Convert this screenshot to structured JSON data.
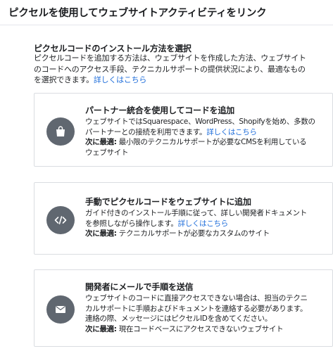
{
  "header": {
    "title": "ピクセルを使用してウェブサイトアクティビティをリンク"
  },
  "intro": {
    "title": "ピクセルコードのインストール方法を選択",
    "lines": [
      "ピクセルコードを追加する方法は、ウェブサイトを作成した方法、ウェブサイト",
      "のコードへのアクセス手段、テクニカルサポートの提供状況により、最適なもの",
      "を選択できます。"
    ],
    "link": "詳しくはこちら"
  },
  "options": [
    {
      "icon": "shopping-bag-icon",
      "title": "パートナー統合を使用してコードを追加",
      "lines": [
        "ウェブサイトではSquarespace、WordPress、Shopifyを始め、多数の",
        "パートナーとの接続を利用できます。"
      ],
      "link": "詳しくはこちら",
      "best_label": "次に最適:",
      "best_lines": [
        " 最小限のテクニカルサポートが必要なCMSを利用している",
        "ウェブサイト"
      ]
    },
    {
      "icon": "code-icon",
      "title": "手動でピクセルコードをウェブサイトに追加",
      "lines": [
        "ガイド付きのインストール手順に従って、詳しい開発者ドキュメント",
        "を参照しながら操作します。"
      ],
      "link": "詳しくはこちら",
      "best_label": "次に最適:",
      "best_lines": [
        " テクニカルサポートが必要なカスタムのサイト"
      ]
    },
    {
      "icon": "envelope-icon",
      "title": "開発者にメールで手順を送信",
      "lines": [
        "ウェブサイトのコードに直接アクセスできない場合は、担当のテクニ",
        "カルサポートに手順およびドキュメントを連絡する必要があります。",
        "連絡の際、メッセージにはピクセルIDを含めてください。"
      ],
      "best_label": "次に最適:",
      "best_lines": [
        " 現在コードベースにアクセスできないウェブサイト"
      ]
    }
  ]
}
